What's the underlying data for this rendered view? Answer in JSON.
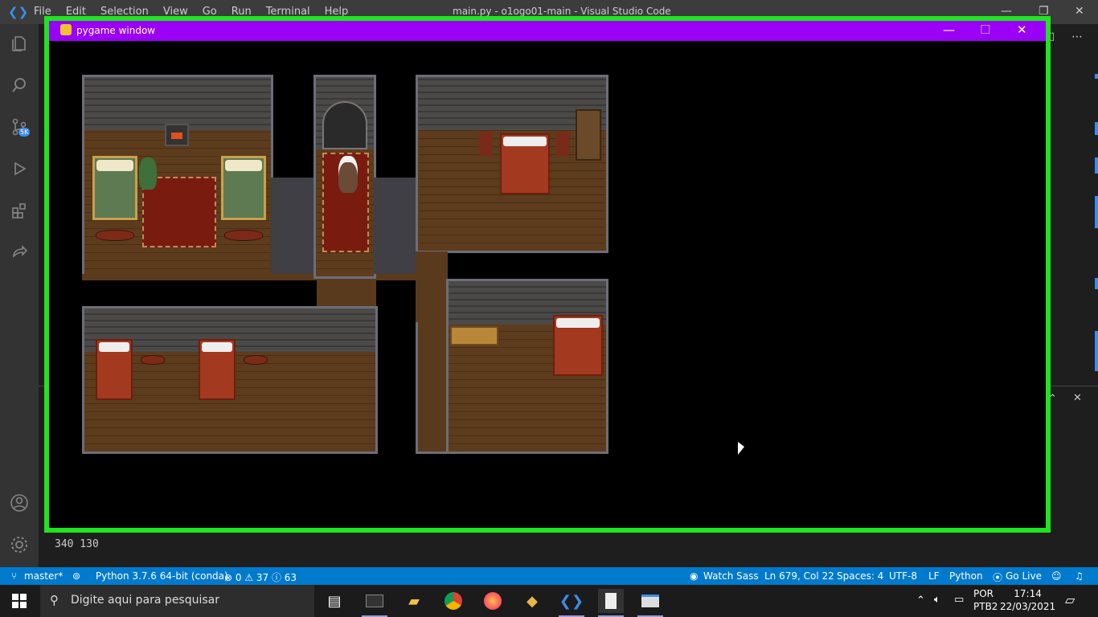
{
  "vscode": {
    "menu": [
      "File",
      "Edit",
      "Selection",
      "View",
      "Go",
      "Run",
      "Terminal",
      "Help"
    ],
    "window_title": "main.py - o1ogo01-main - Visual Studio Code",
    "source_control_badge": "5K",
    "terminal_output": "340 130",
    "terminal_output_cut": "340 130",
    "activity_icons": [
      "explorer-icon",
      "search-icon",
      "source-control-icon",
      "run-debug-icon",
      "extensions-icon",
      "live-share-icon"
    ],
    "bottom_icons": [
      "account-icon",
      "settings-gear-icon"
    ]
  },
  "pygame": {
    "title": "pygame window",
    "minimize": "—",
    "maximize": "☐",
    "close": "✕"
  },
  "statusbar": {
    "branch": "master*",
    "python": "Python 3.7.6 64-bit (conda)",
    "problems": "⊗ 0 ⚠ 37 ⓘ 63",
    "watch_sass": "Watch Sass",
    "position": "Ln 679, Col 22",
    "spaces": "Spaces: 4",
    "encoding": "UTF-8",
    "eol": "LF",
    "language": "Python",
    "go_live": "Go Live"
  },
  "taskbar": {
    "search_placeholder": "Digite aqui para pesquisar",
    "lang_top": "POR",
    "lang_bottom": "PTB2",
    "time": "17:14",
    "date": "22/03/2021"
  },
  "colors": {
    "green_frame": "#1ee51e",
    "pygame_titlebar": "#9a00f5",
    "statusbar": "#007acc"
  }
}
